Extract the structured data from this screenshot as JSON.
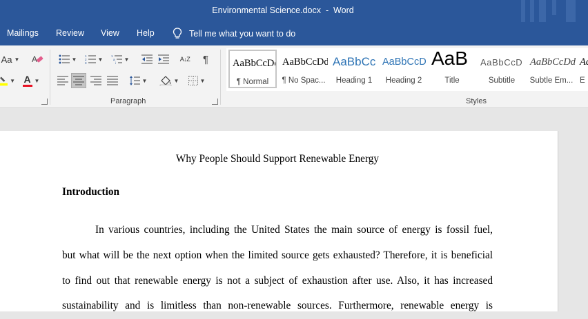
{
  "window": {
    "title": "Environmental Science.docx  -  Word",
    "accent_color": "#2b579a"
  },
  "menu": {
    "items": [
      "Mailings",
      "Review",
      "View",
      "Help"
    ],
    "tell_me": "Tell me what you want to do",
    "tell_me_icon": "lightbulb-icon"
  },
  "ribbon": {
    "font_group": {
      "font_size_label": "Aa",
      "clear_format_icon": "eraser-icon",
      "highlight_icon": "highlighter-icon",
      "font_color_letter": "A",
      "font_color": "#e81123",
      "highlight_color": "#ffff00"
    },
    "paragraph_group": {
      "label": "Paragraph",
      "pilcrow": "¶",
      "sort_label": "A↓Z",
      "icons": [
        "bullets-icon",
        "numbering-icon",
        "multilevel-list-icon",
        "decrease-indent-icon",
        "increase-indent-icon",
        "sort-icon",
        "show-marks-icon",
        "align-left-icon",
        "align-center-icon",
        "align-right-icon",
        "justify-icon",
        "line-spacing-icon",
        "shading-icon",
        "borders-icon"
      ]
    },
    "styles_group": {
      "label": "Styles",
      "items": [
        {
          "sample": "AaBbCcDd",
          "name": "¶ Normal",
          "selected": true
        },
        {
          "sample": "AaBbCcDd",
          "name": "¶ No Spac..."
        },
        {
          "sample": "AaBbCc",
          "name": "Heading 1"
        },
        {
          "sample": "AaBbCcD",
          "name": "Heading 2"
        },
        {
          "sample": "AaB",
          "name": "Title"
        },
        {
          "sample": "AaBbCcD",
          "name": "Subtitle"
        },
        {
          "sample": "AaBbCcDd",
          "name": "Subtle Em..."
        },
        {
          "sample": "AaBbCcDd",
          "name": "E"
        }
      ]
    }
  },
  "document": {
    "title": "Why People Should Support Renewable Energy",
    "heading": "Introduction",
    "lines": [
      "In various countries, including the United States the main source of energy is fossil fuel,",
      "but what will be the next option when the limited source gets exhausted? Therefore, it is beneficial",
      "to find out that renewable energy is not a subject of exhaustion after use. Also, it has increased",
      "sustainability and is limitless than non-renewable sources. Furthermore, renewable energy is"
    ]
  }
}
